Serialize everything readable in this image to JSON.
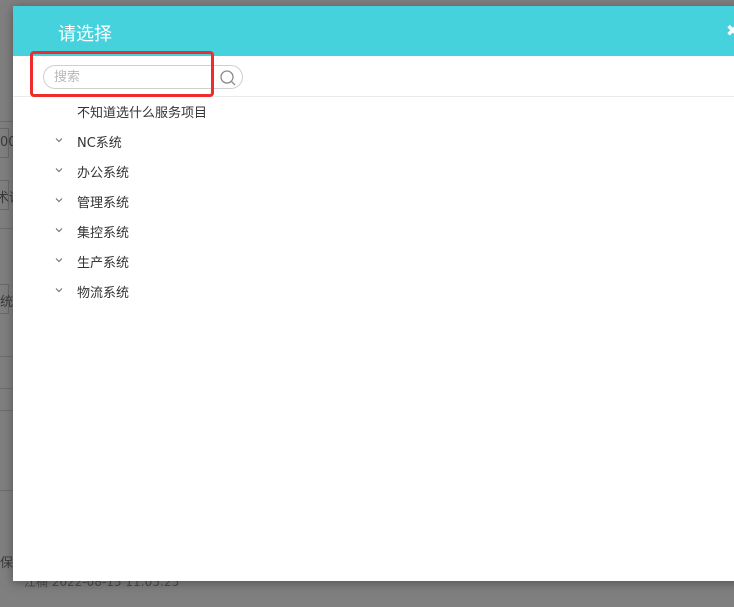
{
  "background": {
    "fragments": [
      "00",
      "术话",
      "统",
      "保"
    ],
    "footer_text": "江楠 2022-08-15 11:05:25"
  },
  "dialog": {
    "title": "请选择",
    "close_icon": "close-icon",
    "search": {
      "placeholder": "搜索",
      "value": "",
      "button_icon": "search-icon"
    },
    "tree": [
      {
        "label": "不知道选什么服务项目",
        "expandable": false
      },
      {
        "label": "NC系统",
        "expandable": true
      },
      {
        "label": "办公系统",
        "expandable": true
      },
      {
        "label": "管理系统",
        "expandable": true
      },
      {
        "label": "集控系统",
        "expandable": true
      },
      {
        "label": "生产系统",
        "expandable": true
      },
      {
        "label": "物流系统",
        "expandable": true
      }
    ]
  },
  "colors": {
    "header": "#46d2dc",
    "highlight": "#ee2c2c",
    "overlay": "#7f7f7f"
  }
}
